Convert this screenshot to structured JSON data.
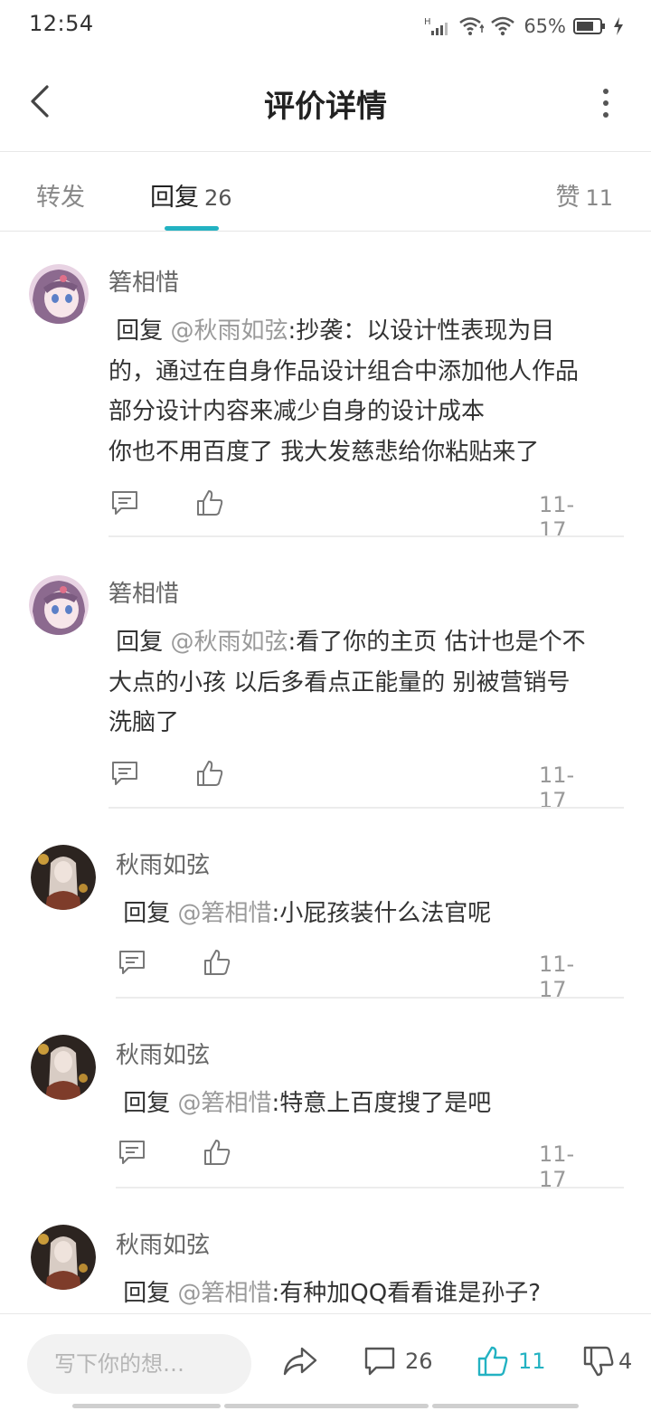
{
  "status": {
    "time": "12:54",
    "battery": "65%"
  },
  "header": {
    "title": "评价详情"
  },
  "tabs": {
    "forward": "转发",
    "reply": "回复",
    "reply_count": "26",
    "like": "赞",
    "like_count": "11"
  },
  "comments": [
    {
      "name": "箬相惜",
      "reply_prefix": " 回复 ",
      "mention": "@秋雨如弦",
      "lines": [
        ":抄袭：以设计性表现为目",
        "的，通过在自身作品设计组合中添加他人作品",
        "部分设计内容来减少自身的设计成本",
        "你也不用百度了 我大发慈悲给你粘贴来了"
      ],
      "date": "11-17"
    },
    {
      "name": "箬相惜",
      "reply_prefix": " 回复 ",
      "mention": "@秋雨如弦",
      "lines": [
        ":看了你的主页 估计也是个不",
        "大点的小孩 以后多看点正能量的 别被营销号",
        "洗脑了"
      ],
      "date": "11-17"
    },
    {
      "name": "秋雨如弦",
      "reply_prefix": " 回复 ",
      "mention": "@箬相惜",
      "lines": [
        ":小屁孩装什么法官呢"
      ],
      "date": "11-17"
    },
    {
      "name": "秋雨如弦",
      "reply_prefix": " 回复 ",
      "mention": "@箬相惜",
      "lines": [
        ":特意上百度搜了是吧"
      ],
      "date": "11-17"
    },
    {
      "name": "秋雨如弦",
      "reply_prefix": " 回复 ",
      "mention": "@箬相惜",
      "lines": [
        ":有种加QQ看看谁是孙子?"
      ],
      "date": ""
    }
  ],
  "bottom_bar": {
    "input_placeholder": "写下你的想…",
    "comment_count": "26",
    "like_count": "11",
    "dislike_count": "4"
  },
  "colors": {
    "accent": "#23b2c2",
    "mention": "#9a9a9a"
  },
  "icons": [
    "back-arrow-icon",
    "more-vertical-icon",
    "comment-icon",
    "thumbs-up-icon",
    "share-icon",
    "thumbs-down-icon",
    "signal-icon",
    "wifi-icon",
    "battery-icon",
    "charging-icon"
  ]
}
